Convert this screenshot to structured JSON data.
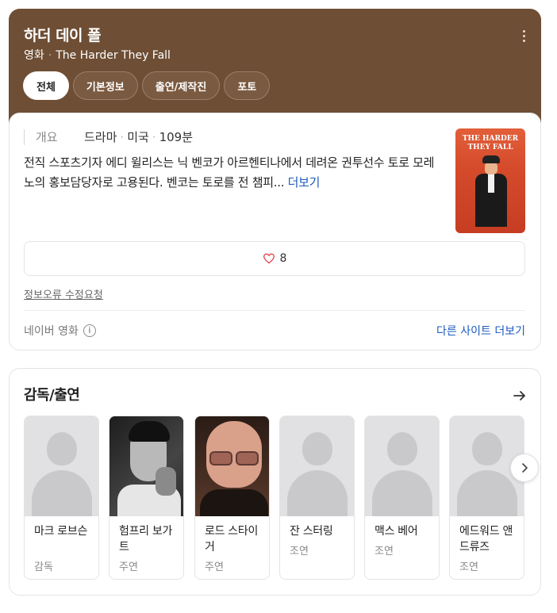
{
  "header": {
    "title": "하더 데이 폴",
    "category": "영화",
    "english_title": "The Harder They Fall",
    "more_icon": "more-vertical-icon",
    "tabs": [
      {
        "label": "전체",
        "active": true
      },
      {
        "label": "기본정보",
        "active": false
      },
      {
        "label": "출연/제작진",
        "active": false
      },
      {
        "label": "포토",
        "active": false
      }
    ],
    "background_color": "#6e4e34"
  },
  "overview": {
    "label": "개요",
    "genre": "드라마",
    "country": "미국",
    "runtime": "109분",
    "synopsis": "전직 스포츠기자 에디 윌리스는 닉 벤코가 아르헨티나에서 데려온 권투선수 토로 모레노의 홍보담당자로 고용된다. 벤코는 토로를 전 챔피...",
    "more_link": "더보기",
    "poster": {
      "title_line1": "THE HARDER",
      "title_line2": "THEY FALL"
    },
    "likes": {
      "count": "8",
      "icon": "heart-icon"
    },
    "report_link": "정보오류 수정요청",
    "source": "네이버 영화",
    "source_info_icon": "info-icon",
    "other_sites_link": "다른 사이트 더보기"
  },
  "cast_section": {
    "title": "감독/출연",
    "arrow_icon": "arrow-right-icon",
    "next_icon": "chevron-right-icon",
    "people": [
      {
        "name": "마크 로브슨",
        "role": "감독",
        "photo": "placeholder"
      },
      {
        "name": "험프리 보가트",
        "role": "주연",
        "photo": "photo"
      },
      {
        "name": "로드 스타이거",
        "role": "주연",
        "photo": "photo"
      },
      {
        "name": "잔 스터링",
        "role": "조연",
        "photo": "placeholder"
      },
      {
        "name": "맥스 베어",
        "role": "조연",
        "photo": "placeholder"
      },
      {
        "name": "에드워드 앤드류즈",
        "role": "조연",
        "photo": "placeholder"
      }
    ]
  },
  "colors": {
    "accent_link": "#1c5ac0",
    "heart": "#e0474c"
  }
}
